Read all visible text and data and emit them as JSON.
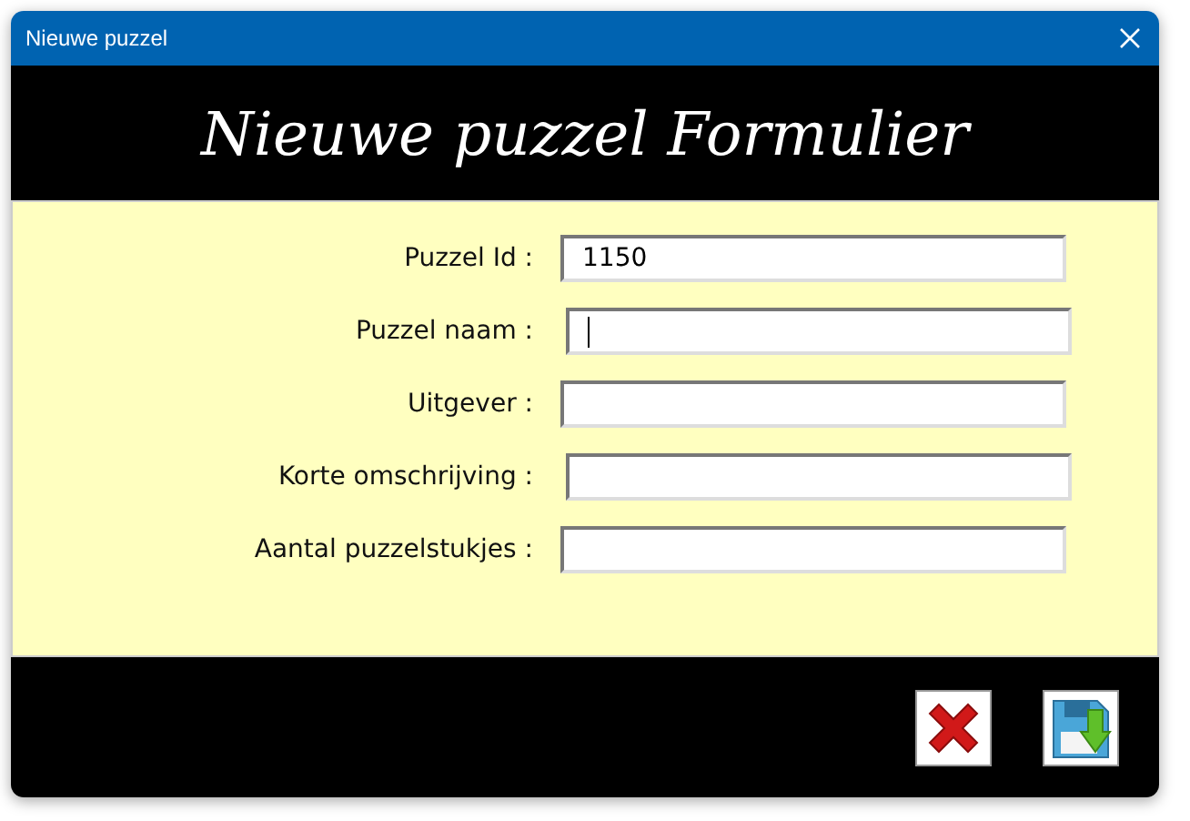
{
  "window": {
    "title": "Nieuwe puzzel"
  },
  "header": {
    "title": "Nieuwe puzzel Formulier"
  },
  "fields": [
    {
      "label": "Puzzel Id :",
      "value": "1150",
      "focused": false
    },
    {
      "label": "Puzzel naam :",
      "focused": true
    },
    {
      "label": "Uitgever :",
      "focused": false
    },
    {
      "label": "Korte omschrijving :",
      "focused": false
    },
    {
      "label": "Aantal puzzelstukjes :",
      "focused": false
    }
  ],
  "buttons": [
    {
      "kind": "cancel"
    },
    {
      "kind": "save"
    }
  ]
}
